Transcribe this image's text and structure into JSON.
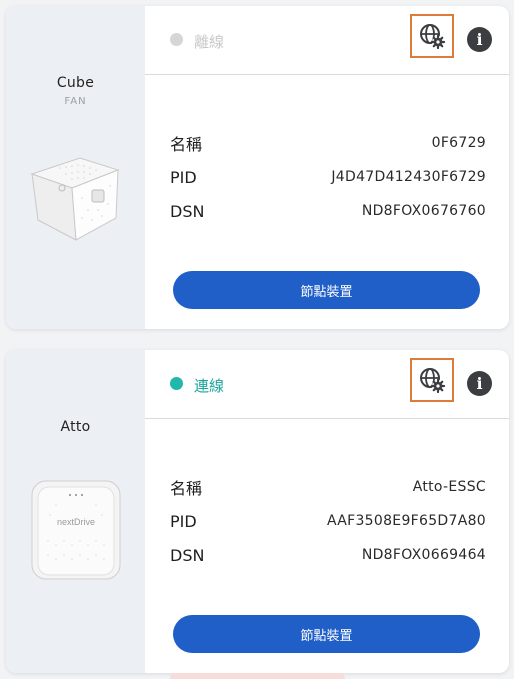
{
  "devices": [
    {
      "product_name": "Cube",
      "product_type": "FAN",
      "status": "離線",
      "labels": {
        "name": "名稱",
        "pid": "PID",
        "dsn": "DSN"
      },
      "values": {
        "name": "0F6729",
        "pid": "J4D47D412430F6729",
        "dsn": "ND8FOX0676760"
      },
      "action_label": "節點裝置",
      "settings_icon": "globe-gear-icon",
      "info_icon": "info-icon"
    },
    {
      "product_name": "Atto",
      "product_type": "",
      "status": "連線",
      "labels": {
        "name": "名稱",
        "pid": "PID",
        "dsn": "DSN"
      },
      "values": {
        "name": "Atto-ESSC",
        "pid": "AAF3508E9F65D7A80",
        "dsn": "ND8FOX0669464"
      },
      "action_label": "節點裝置",
      "device_logo_text": "nextDrive",
      "settings_icon": "globe-gear-icon",
      "info_icon": "info-icon"
    }
  ],
  "colors": {
    "offline": "#d6d6d6",
    "online": "#20b7ad",
    "primary_button": "#1f5fc7",
    "highlight_border": "#e07a3a"
  }
}
